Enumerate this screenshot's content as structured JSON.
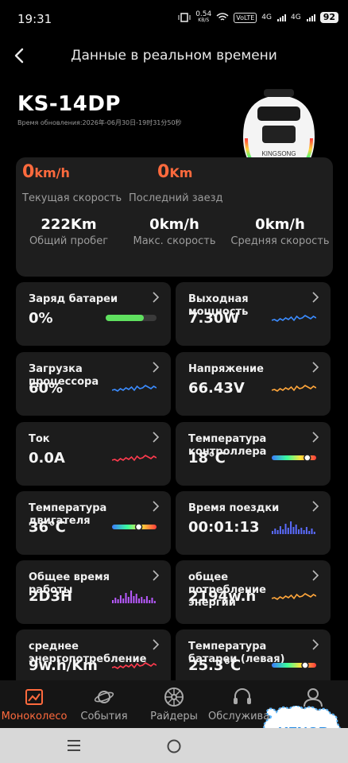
{
  "status_bar": {
    "time": "19:31",
    "net_speed": "0.54",
    "net_unit": "KB/S",
    "volte": "VoLTE",
    "sig1": "4G",
    "sig2": "4G",
    "battery": "92"
  },
  "header": {
    "title": "Данные в реальном времени",
    "model": "KS-14DP",
    "updated": "Время обновления:2026年-06月30日-19时31分50秒"
  },
  "summary": {
    "current_speed_value": "0",
    "current_speed_unit": "km/h",
    "current_speed_label": "Текущая скорость",
    "last_ride_value": "0",
    "last_ride_unit": "Km",
    "last_ride_label": "Последний заезд",
    "total_mileage_value": "222Km",
    "total_mileage_label": "Общий пробег",
    "max_speed_value": "0km/h",
    "max_speed_label": "Макс. скорость",
    "avg_speed_value": "0km/h",
    "avg_speed_label": "Средняя скорость"
  },
  "cards": [
    {
      "label": "Заряд батареи",
      "value": "0%",
      "viz": "battery-bar",
      "level": 0.75
    },
    {
      "label": "Выходная мощность",
      "value": "7.30W",
      "viz": "wave-blue"
    },
    {
      "label": "Загрузка процессора",
      "value": "60%",
      "viz": "wave-blue"
    },
    {
      "label": "Напряжение",
      "value": "66.43V",
      "viz": "wave-orange"
    },
    {
      "label": "Ток",
      "value": "0.0A",
      "viz": "wave-red"
    },
    {
      "label": "Температура контроллера",
      "value": "18℃",
      "viz": "gradient-bar",
      "level": 0.8
    },
    {
      "label": "Температура двигателя",
      "value": "36℃",
      "viz": "gradient-bar",
      "level": 0.6
    },
    {
      "label": "Время поездки",
      "value": "00:01:13",
      "viz": "bars-blue"
    },
    {
      "label": "Общее время работы",
      "value": "2D3H",
      "viz": "bars-purple"
    },
    {
      "label": " общее потребление энергии",
      "value": "2194w.h",
      "viz": "wave-orange"
    },
    {
      "label": " среднее энергопотребление",
      "value": "9w.h/Km",
      "viz": "wave-red"
    },
    {
      "label": "Температура батареи (левая)",
      "value": "25.3℃",
      "viz": "gradient-bar",
      "level": 0.75
    }
  ],
  "nav": [
    {
      "label": "Моноколесо",
      "icon": "monocycle-icon",
      "active": true
    },
    {
      "label": "События",
      "icon": "planet-icon",
      "active": false
    },
    {
      "label": "Райдеры",
      "icon": "wheel-icon",
      "active": false
    },
    {
      "label": "Обслуживание",
      "icon": "headset-icon",
      "active": false
    },
    {
      "label": "Профиль",
      "icon": "person-icon",
      "active": false
    }
  ],
  "brand_on_wheel": "KINGSONG",
  "watermark": "KZNOB",
  "colors": {
    "accent": "#ff6a3d",
    "card": "#1c1c1c",
    "battery_green": "#5fe05f"
  }
}
